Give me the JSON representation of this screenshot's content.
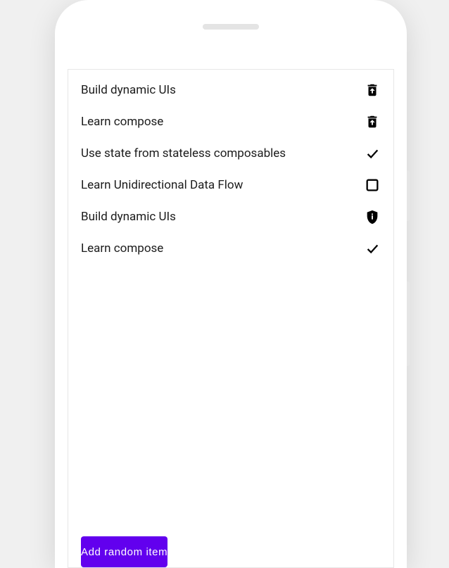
{
  "list": {
    "items": [
      {
        "label": "Build dynamic UIs",
        "icon": "restore-trash-icon"
      },
      {
        "label": "Learn compose",
        "icon": "restore-trash-icon"
      },
      {
        "label": "Use state from stateless composables",
        "icon": "check-icon"
      },
      {
        "label": "Learn Unidirectional Data Flow",
        "icon": "checkbox-empty-icon"
      },
      {
        "label": "Build dynamic UIs",
        "icon": "shield-info-icon"
      },
      {
        "label": "Learn compose",
        "icon": "check-icon"
      }
    ]
  },
  "button": {
    "label": "Add random item"
  },
  "colors": {
    "primary": "#6200EE"
  }
}
